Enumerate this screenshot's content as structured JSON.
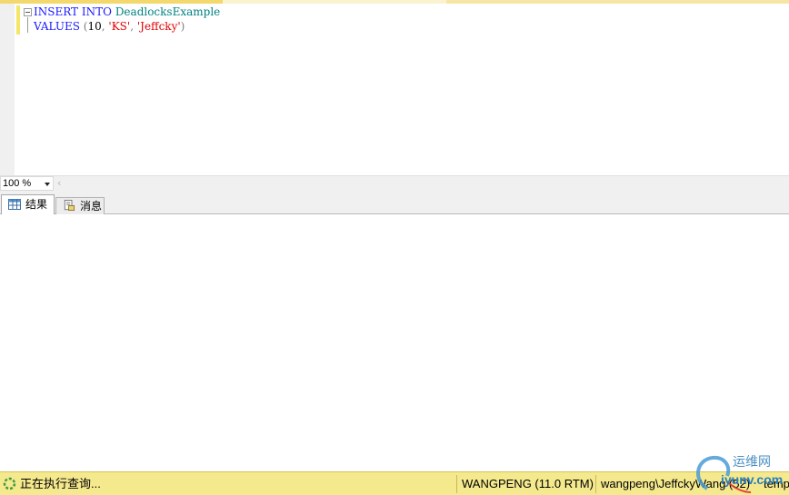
{
  "editor": {
    "line1": {
      "kw1": "INSERT",
      "kw2": "INTO",
      "table": "DeadlocksExample"
    },
    "line2": {
      "kw": "VALUES",
      "open": "(",
      "num": "10",
      "comma1": ",",
      "str1": "'KS'",
      "comma2": ",",
      "str2": "'Jeffcky'",
      "close": ")"
    }
  },
  "zoom": {
    "value": "100 %",
    "scroll_left_glyph": "‹"
  },
  "tabs": [
    {
      "label": "结果",
      "icon": "grid-icon"
    },
    {
      "label": "消息",
      "icon": "messages-icon"
    }
  ],
  "status": {
    "message": "正在执行查询...",
    "server": "WANGPENG (11.0 RTM)",
    "user": "wangpeng\\JeffckyWang (52)",
    "database": "temp"
  },
  "watermark": {
    "top": "运维网",
    "bottom": "iyunv.com"
  },
  "colors": {
    "status_bar": "#f5e98e",
    "keyword": "#1a1aff",
    "object": "#008080",
    "string": "#e00000",
    "change_bar": "#f5e66a"
  }
}
